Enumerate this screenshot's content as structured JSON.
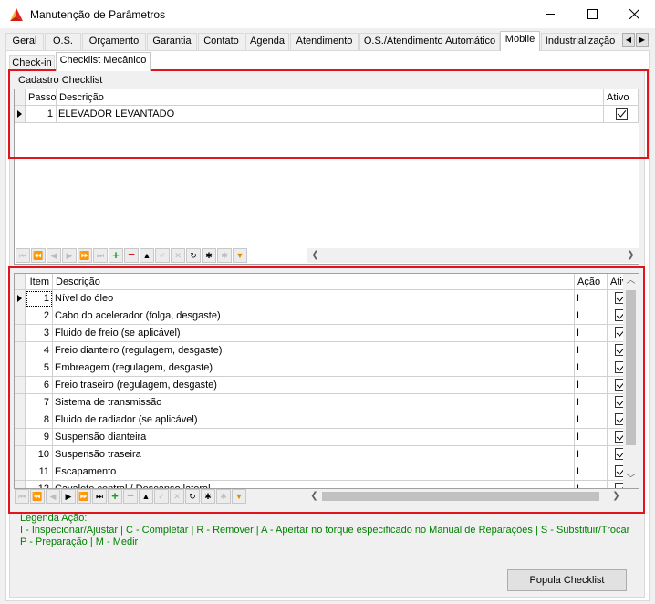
{
  "window": {
    "title": "Manutenção de Parâmetros"
  },
  "tabs": [
    "Geral",
    "O.S.",
    "Orçamento",
    "Garantia",
    "Contato",
    "Agenda",
    "Atendimento",
    "O.S./Atendimento Automático",
    "Mobile",
    "Industrialização"
  ],
  "active_tab": "Mobile",
  "subtabs": [
    "Check-in",
    "Checklist Mecânico"
  ],
  "active_subtab": "Checklist Mecânico",
  "checklist_group": {
    "title": "Cadastro Checklist",
    "columns": {
      "passo": "Passo",
      "descricao": "Descrição",
      "ativo": "Ativo"
    },
    "rows": [
      {
        "passo": "1",
        "descricao": "ELEVADOR LEVANTADO",
        "ativo": true
      }
    ]
  },
  "items_grid": {
    "columns": {
      "item": "Item",
      "descricao": "Descrição",
      "acao": "Ação",
      "ativo": "Ativo"
    },
    "rows": [
      {
        "item": "1",
        "descricao": "Nível do óleo",
        "acao": "I",
        "ativo": true
      },
      {
        "item": "2",
        "descricao": "Cabo do acelerador (folga, desgaste)",
        "acao": "I",
        "ativo": true
      },
      {
        "item": "3",
        "descricao": "Fluido de freio (se aplicável)",
        "acao": "I",
        "ativo": true
      },
      {
        "item": "4",
        "descricao": "Freio dianteiro (regulagem, desgaste)",
        "acao": "I",
        "ativo": true
      },
      {
        "item": "5",
        "descricao": "Embreagem (regulagem, desgaste)",
        "acao": "I",
        "ativo": true
      },
      {
        "item": "6",
        "descricao": "Freio traseiro (regulagem, desgaste)",
        "acao": "I",
        "ativo": true
      },
      {
        "item": "7",
        "descricao": "Sistema de transmissão",
        "acao": "I",
        "ativo": true
      },
      {
        "item": "8",
        "descricao": "Fluido de radiador (se aplicável)",
        "acao": "I",
        "ativo": true
      },
      {
        "item": "9",
        "descricao": "Suspensão dianteira",
        "acao": "I",
        "ativo": true
      },
      {
        "item": "10",
        "descricao": "Suspensão traseira",
        "acao": "I",
        "ativo": true
      },
      {
        "item": "11",
        "descricao": "Escapamento",
        "acao": "I",
        "ativo": true
      },
      {
        "item": "12",
        "descricao": "Cavalete central / Descanso lateral",
        "acao": "I",
        "ativo": true
      }
    ]
  },
  "nav_buttons": [
    {
      "icon": "first-icon",
      "glyph": "⏮"
    },
    {
      "icon": "prior-page-icon",
      "glyph": "⏪"
    },
    {
      "icon": "prior-icon",
      "glyph": "◀"
    },
    {
      "icon": "next-icon",
      "glyph": "▶"
    },
    {
      "icon": "next-page-icon",
      "glyph": "⏩"
    },
    {
      "icon": "last-icon",
      "glyph": "⏭"
    },
    {
      "icon": "insert-icon",
      "glyph": "+"
    },
    {
      "icon": "delete-icon",
      "glyph": "−"
    },
    {
      "icon": "edit-icon",
      "glyph": "▲"
    },
    {
      "icon": "post-icon",
      "glyph": "✓"
    },
    {
      "icon": "cancel-icon",
      "glyph": "✕"
    },
    {
      "icon": "refresh-icon",
      "glyph": "↻"
    },
    {
      "icon": "asterisk-icon",
      "glyph": "✱"
    },
    {
      "icon": "asterisk-disabled-icon",
      "glyph": "✱"
    },
    {
      "icon": "filter-icon",
      "glyph": "▼"
    }
  ],
  "legend": {
    "line1": "Legenda Ação:",
    "line2": "I - Inspecionar/Ajustar | C - Completar | R - Remover | A - Apertar no torque especificado no Manual de Reparações | S - Substituir/Trocar",
    "line3": "P - Preparação | M - Medir"
  },
  "popula_button": "Popula Checklist",
  "colors": {
    "highlight_border": "#e3131b",
    "legend_text": "#008000"
  }
}
